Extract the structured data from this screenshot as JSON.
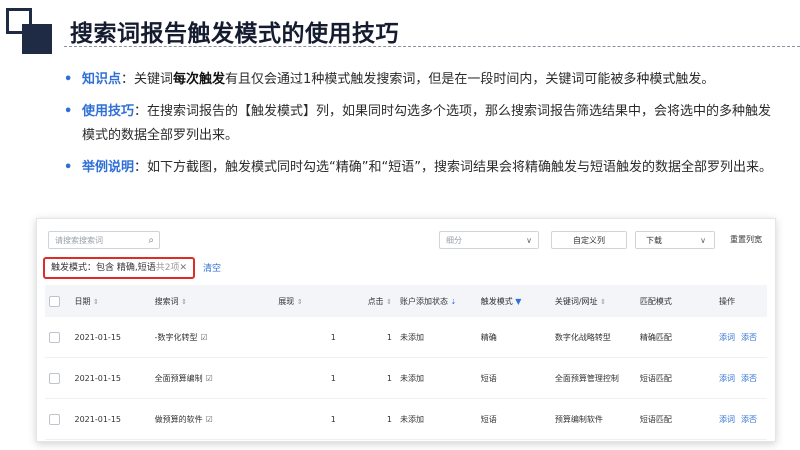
{
  "header": {
    "title": "搜索词报告触发模式的使用技巧"
  },
  "bullets": [
    {
      "key": "知识点",
      "pre": "：关键词",
      "bold": "每次触发",
      "post": "有且仅会通过1种模式触发搜索词，但是在一段时间内，关键词可能被多种模式触发。"
    },
    {
      "key": "使用技巧",
      "text": "：在搜索词报告的【触发模式】列，如果同时勾选多个选项，那么搜索词报告筛选结果中，会将选中的多种触发模式的数据全部罗列出来。"
    },
    {
      "key": "举例说明",
      "text": "：如下方截图，触发模式同时勾选“精确”和“短语”，搜索词结果会将精确触发与短语触发的数据全部罗列出来。"
    }
  ],
  "toolbar": {
    "search_placeholder": "请搜索搜索词",
    "segment_placeholder": "细分",
    "custom_columns": "自定义列",
    "download": "下载",
    "reset_width": "重置列宽"
  },
  "filter": {
    "label": "触发模式：包含 精确,短语",
    "count": "共2项",
    "clear": "清空"
  },
  "table": {
    "headers": [
      "日期",
      "搜索词",
      "展现",
      "点击",
      "账户添加状态",
      "触发模式",
      "关键词/网址",
      "匹配模式",
      "操作"
    ],
    "rows": [
      {
        "date": "2021-01-15",
        "term": "-数字化转型",
        "impressions": "1",
        "clicks": "1",
        "status": "未添加",
        "trigger": "精确",
        "keyword": "数字化战略转型",
        "match": "精确匹配",
        "act1": "添词",
        "act2": "添否"
      },
      {
        "date": "2021-01-15",
        "term": "全面预算编制",
        "impressions": "1",
        "clicks": "1",
        "status": "未添加",
        "trigger": "短语",
        "keyword": "全面预算管理控制",
        "match": "短语匹配",
        "act1": "添词",
        "act2": "添否"
      },
      {
        "date": "2021-01-15",
        "term": "做预算的软件",
        "impressions": "1",
        "clicks": "1",
        "status": "未添加",
        "trigger": "短语",
        "keyword": "预算编制软件",
        "match": "短语匹配",
        "act1": "添词",
        "act2": "添否"
      }
    ]
  },
  "colors": {
    "accent": "#2f6fd6",
    "highlight_border": "#e02b2b",
    "title": "#151c30"
  }
}
